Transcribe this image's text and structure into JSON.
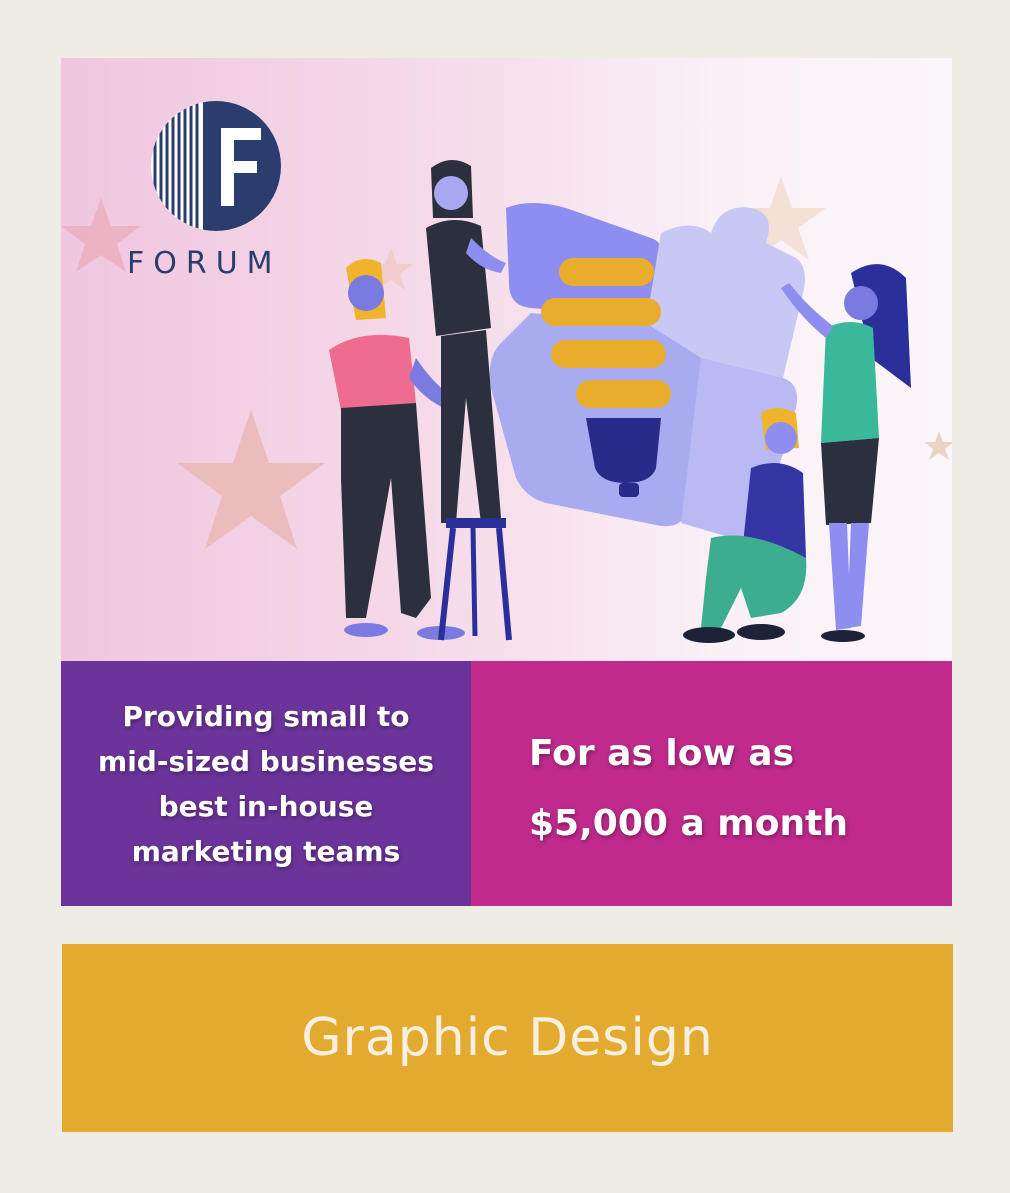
{
  "logo": {
    "wordmark": "FORUM",
    "letter": "F"
  },
  "banner": {
    "left_text": "Providing small to\nmid-sized businesses\nbest in-house\nmarketing teams",
    "right_text": "For as low as\n$5,000 a month"
  },
  "caption": {
    "label": "Graphic Design"
  },
  "colors": {
    "page_background": "#efebe5",
    "panel_left": "#6c349a",
    "panel_right": "#c02a8c",
    "caption_background": "#e2ab2f",
    "logo_navy": "#2a3e6e"
  },
  "icons": [
    "forum-logo-icon",
    "star-icon",
    "lightbulb-icon",
    "puzzle-icon"
  ]
}
